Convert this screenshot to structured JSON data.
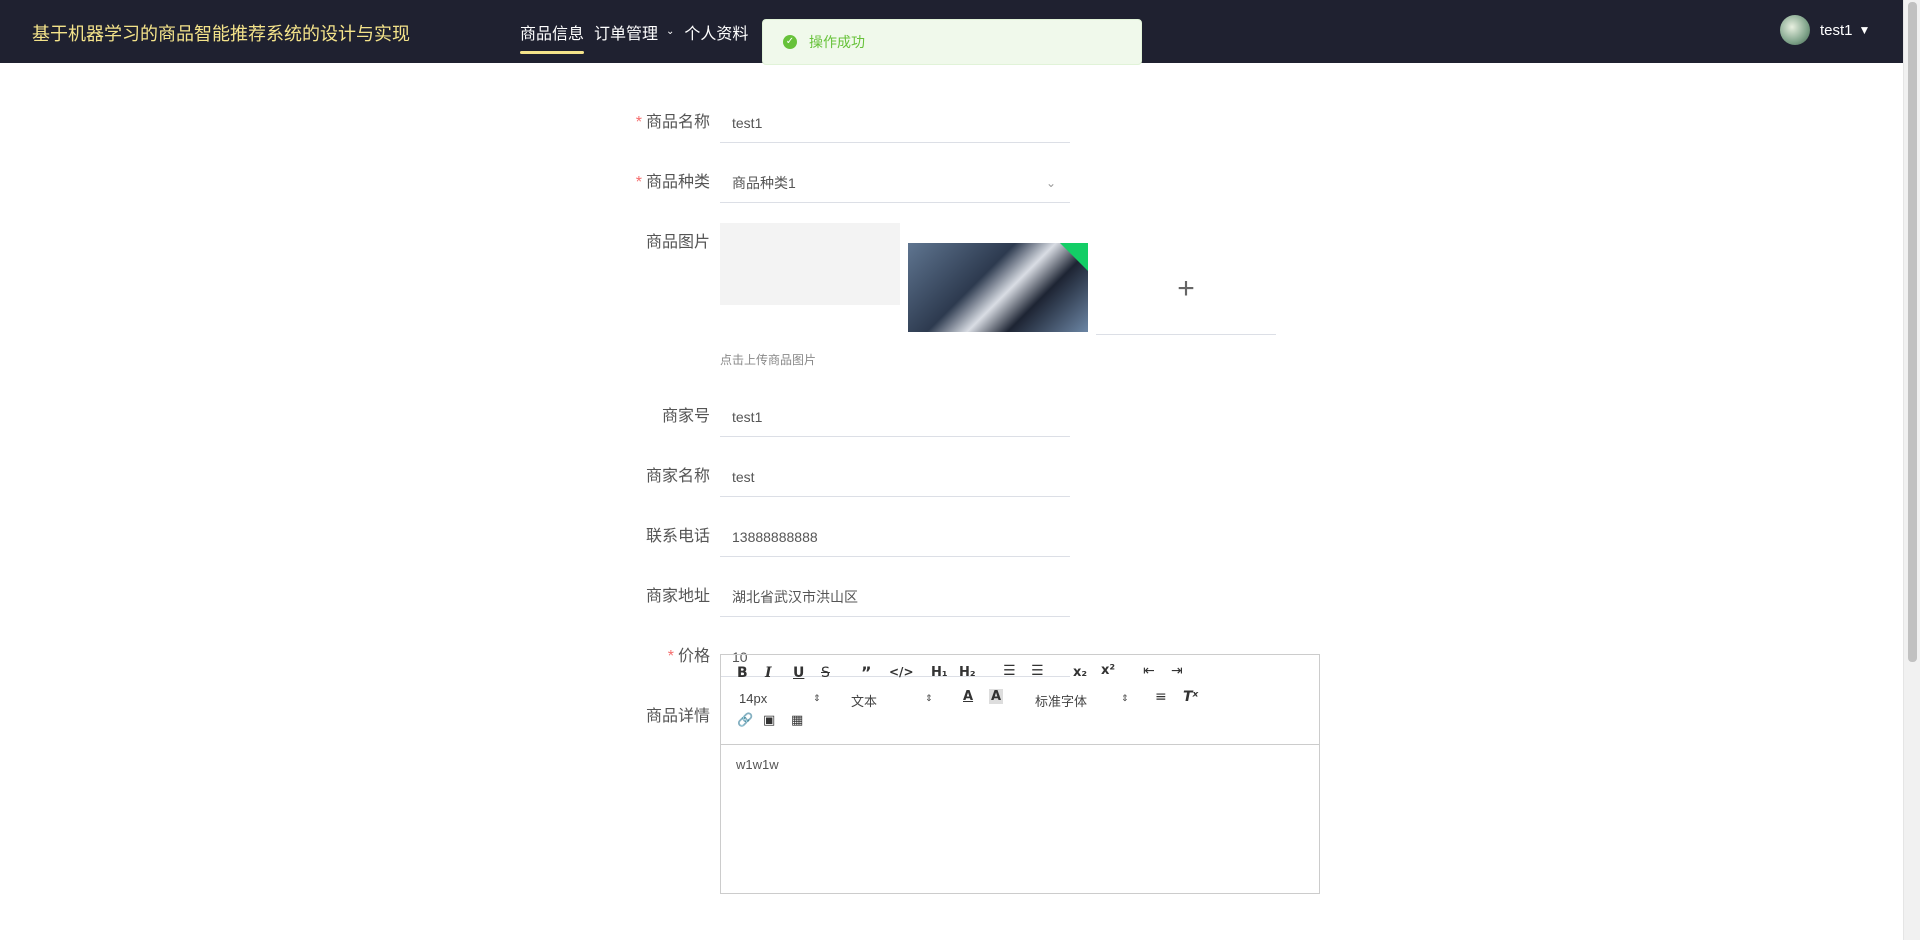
{
  "header": {
    "title": "基于机器学习的商品智能推荐系统的设计与实现",
    "nav": [
      {
        "label": "商品信息",
        "active": true
      },
      {
        "label": "订单管理",
        "active": false,
        "has_dropdown": true
      },
      {
        "label": "个人资料",
        "active": false
      }
    ],
    "user": {
      "name": "test1",
      "caret_icon": "caret-down-icon",
      "avatar_icon": "avatar-icon"
    }
  },
  "toast": {
    "text": "操作成功",
    "icon": "success-icon",
    "color": "#67c23a"
  },
  "form": {
    "name": {
      "label": "商品名称",
      "required": true,
      "value": "test1"
    },
    "category": {
      "label": "商品种类",
      "required": true,
      "value": "商品种类1",
      "icon": "chevron-down-icon"
    },
    "image": {
      "label": "商品图片",
      "hint": "点击上传商品图片",
      "upload_icon": "plus-icon"
    },
    "merchant_no": {
      "label": "商家号",
      "value": "test1"
    },
    "merchant_name": {
      "label": "商家名称",
      "value": "test"
    },
    "phone": {
      "label": "联系电话",
      "value": "13888888888"
    },
    "address": {
      "label": "商家地址",
      "value": "湖北省武汉市洪山区"
    },
    "price": {
      "label": "价格",
      "required": true,
      "value": "10"
    },
    "detail": {
      "label": "商品详情",
      "font_size": "14px",
      "block_type": "文本",
      "font_family": "标准字体",
      "content": "w1w1w"
    }
  },
  "colors": {
    "topbar": "#1f2130",
    "title": "#f4e38a",
    "required": "#f56c6c",
    "success": "#67c23a"
  }
}
